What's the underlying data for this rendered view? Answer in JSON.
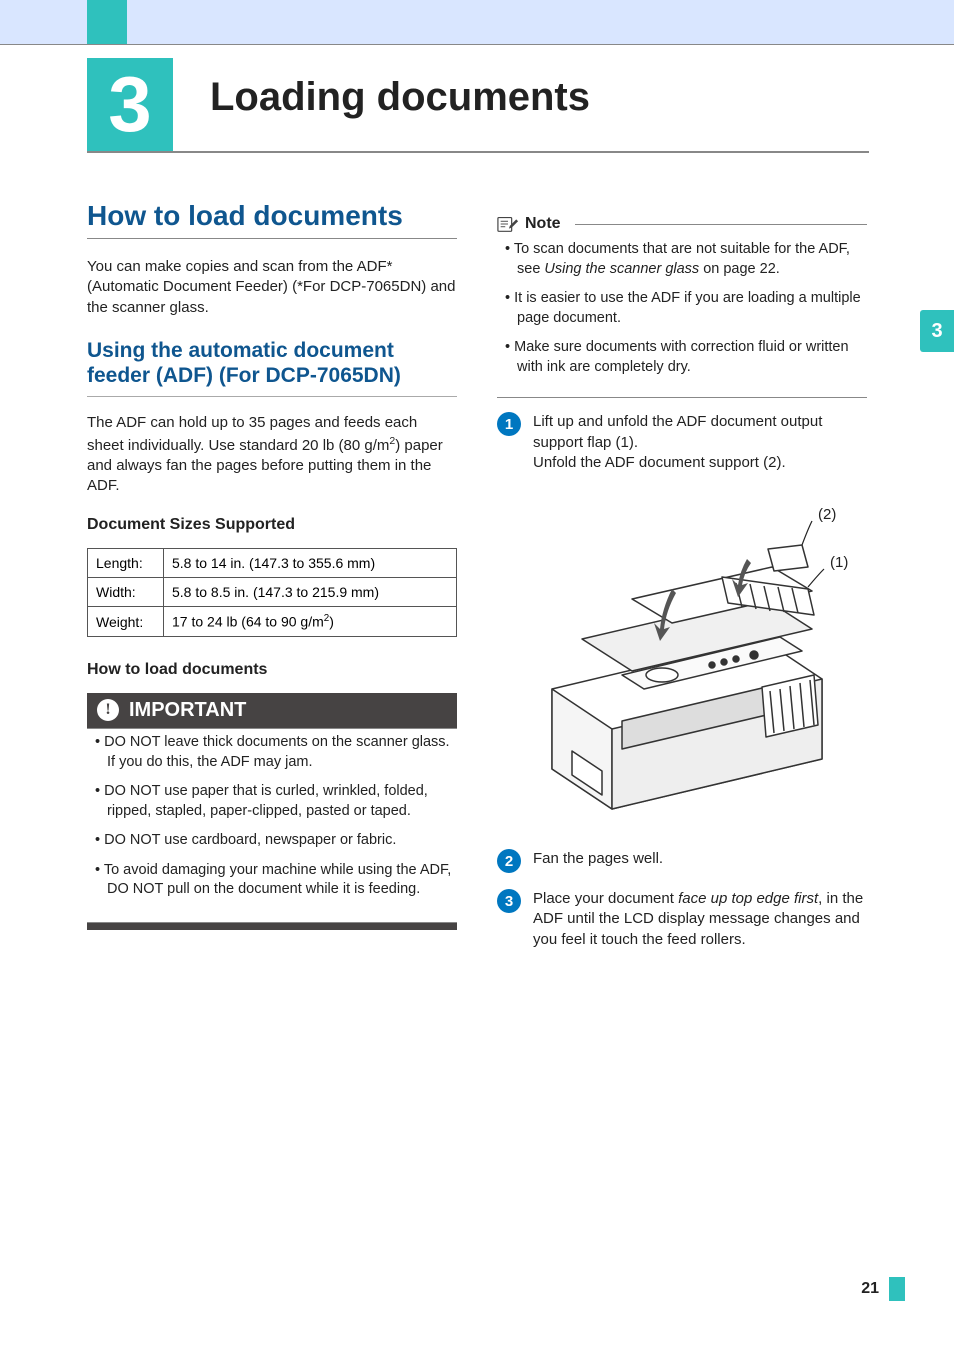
{
  "chapter": {
    "number": "3",
    "title": "Loading documents"
  },
  "side_tab": "3",
  "left": {
    "section_title": "How to load documents",
    "intro": "You can make copies and scan from the ADF* (Automatic Document Feeder) (*For DCP-7065DN) and the scanner glass.",
    "subsection_title": "Using the automatic document feeder (ADF) (For DCP-7065DN)",
    "adf_desc_1": "The ADF can hold up to 35 pages and feeds each sheet individually. Use standard 20 lb (80 g/m",
    "adf_desc_sup": "2",
    "adf_desc_2": ") paper and always fan the pages before putting them in the ADF.",
    "sizes_heading": "Document Sizes Supported",
    "spec_table": {
      "rows": [
        {
          "label": "Length:",
          "value": "5.8 to 14 in. (147.3 to 355.6 mm)"
        },
        {
          "label": "Width:",
          "value": "5.8 to 8.5 in. (147.3 to 215.9 mm)"
        },
        {
          "label": "Weight:",
          "value_prefix": "17 to 24 lb (64 to 90 g/m",
          "value_sup": "2",
          "value_suffix": ")"
        }
      ]
    },
    "howto_heading": "How to load documents",
    "important": {
      "label": "IMPORTANT",
      "items": [
        "DO NOT leave thick documents on the scanner glass. If you do this, the ADF may jam.",
        "DO NOT use paper that is curled, wrinkled, folded, ripped, stapled, paper-clipped, pasted or taped.",
        "DO NOT use cardboard, newspaper or fabric.",
        "To avoid damaging your machine while using the ADF, DO NOT pull on the document while it is feeding."
      ]
    }
  },
  "right": {
    "note": {
      "label": "Note",
      "items_pre": "To scan documents that are not suitable for the ADF, see ",
      "items_link": "Using the scanner glass",
      "items_post": " on page 22.",
      "item2": "It is easier to use the ADF if you are loading a multiple page document.",
      "item3": "Make sure documents with correction fluid or written with ink are completely dry."
    },
    "steps": {
      "s1_a": "Lift up and unfold the ADF document output support flap (1).",
      "s1_b": "Unfold the ADF document support (2).",
      "s2": "Fan the pages well.",
      "s3_a": "Place your document ",
      "s3_i": "face up top edge first",
      "s3_b": ", in the ADF until the LCD display message changes and you feel it touch the feed rollers."
    },
    "figure_callouts": {
      "c1": "(1)",
      "c2": "(2)"
    }
  },
  "page_number": "21"
}
